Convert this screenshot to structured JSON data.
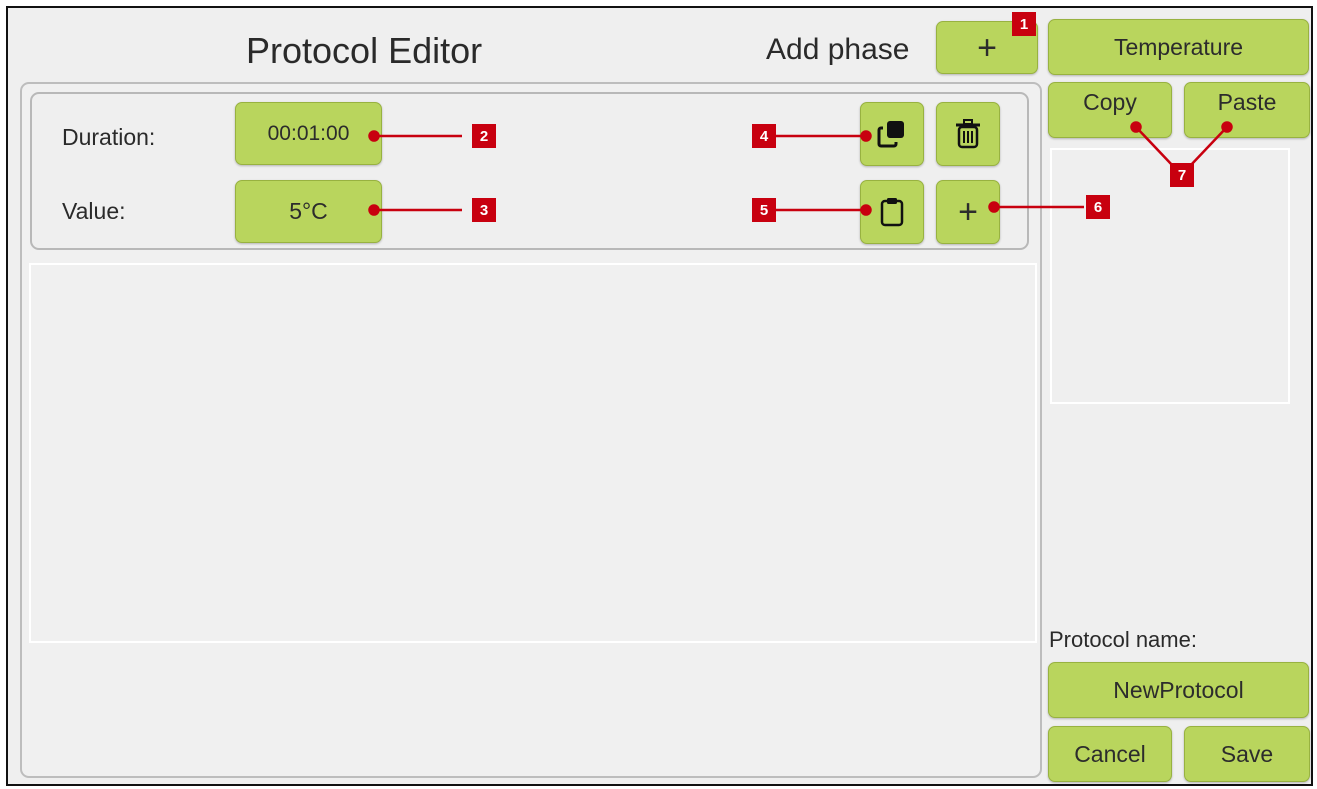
{
  "header": {
    "title": "Protocol Editor",
    "add_phase_label": "Add phase",
    "add_phase_button": "+"
  },
  "phase": {
    "duration_label": "Duration:",
    "duration_value": "00:01:00",
    "value_label": "Value:",
    "value_value": "5°C",
    "add_button": "+"
  },
  "sidebar": {
    "temperature_button": "Temperature",
    "copy_button": "Copy",
    "paste_button": "Paste",
    "protocol_name_label": "Protocol name:",
    "protocol_name_value": "NewProtocol",
    "cancel_button": "Cancel",
    "save_button": "Save"
  },
  "markers": [
    "1",
    "2",
    "3",
    "4",
    "5",
    "6",
    "7"
  ],
  "icons": {
    "copy": "copy-icon",
    "delete": "trash-icon",
    "paste": "clipboard-icon",
    "add": "plus-icon"
  },
  "colors": {
    "button_fill": "#b9d55d",
    "button_border": "#98b240",
    "marker": "#c8000f",
    "background": "#efefef"
  }
}
